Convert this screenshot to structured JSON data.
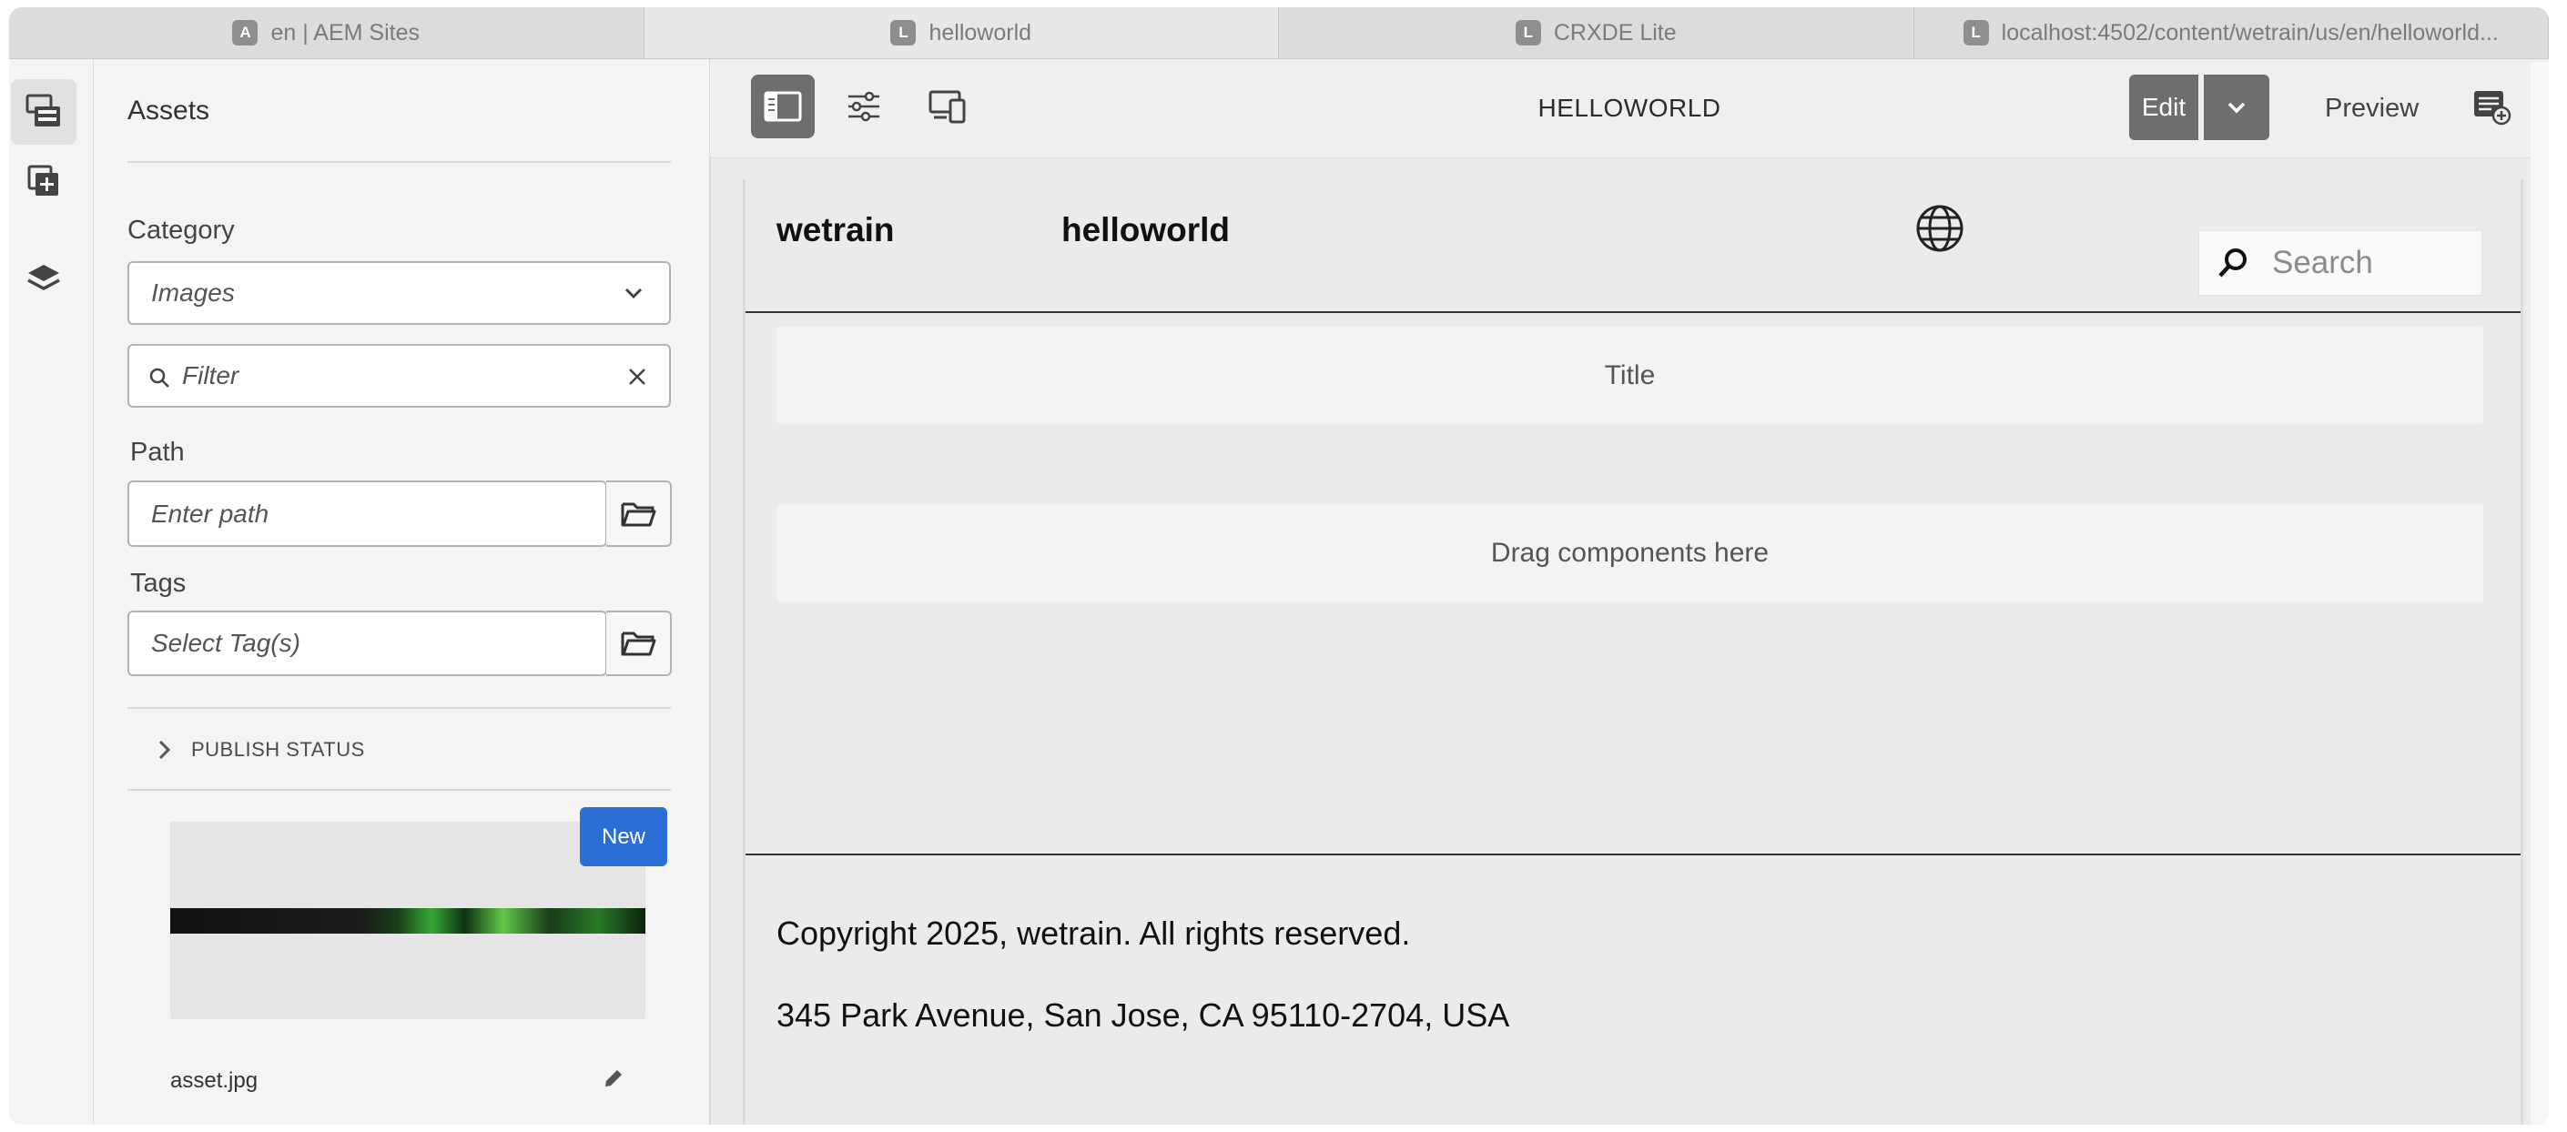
{
  "browser": {
    "tabs": [
      {
        "favicon": "A",
        "title": "en | AEM Sites"
      },
      {
        "favicon": "L",
        "title": "helloworld"
      },
      {
        "favicon": "L",
        "title": "CRXDE Lite"
      },
      {
        "favicon": "L",
        "title": "localhost:4502/content/wetrain/us/en/helloworld..."
      }
    ]
  },
  "rail": {
    "items": [
      {
        "icon": "assets-finder-icon",
        "active": true
      },
      {
        "icon": "components-icon",
        "active": false
      },
      {
        "icon": "content-tree-layers-icon",
        "active": false
      }
    ]
  },
  "assets_panel": {
    "title": "Assets",
    "category_label": "Category",
    "category_value": "Images",
    "filter_placeholder": "Filter",
    "path_label": "Path",
    "path_placeholder": "Enter path",
    "tags_label": "Tags",
    "tags_placeholder": "Select Tag(s)",
    "publish_status_label": "PUBLISH STATUS",
    "asset": {
      "badge": "New",
      "name": "asset.jpg"
    }
  },
  "toolbar": {
    "page_name": "HELLOWORLD",
    "edit_label": "Edit",
    "preview_label": "Preview"
  },
  "page": {
    "brand": "wetrain",
    "nav_link": "helloworld",
    "search_placeholder": "Search",
    "title_component": "Title",
    "drop_zone": "Drag components here",
    "footer_copyright": "Copyright 2025, wetrain. All rights reserved.",
    "footer_address": "345 Park Avenue, San Jose, CA 95110-2704, USA"
  },
  "colors": {
    "accent_blue": "#2b6fd6",
    "toolbar_active": "#6e6e6e",
    "panel_bg": "#f4f4f4",
    "canvas_bg": "#ebebeb"
  }
}
